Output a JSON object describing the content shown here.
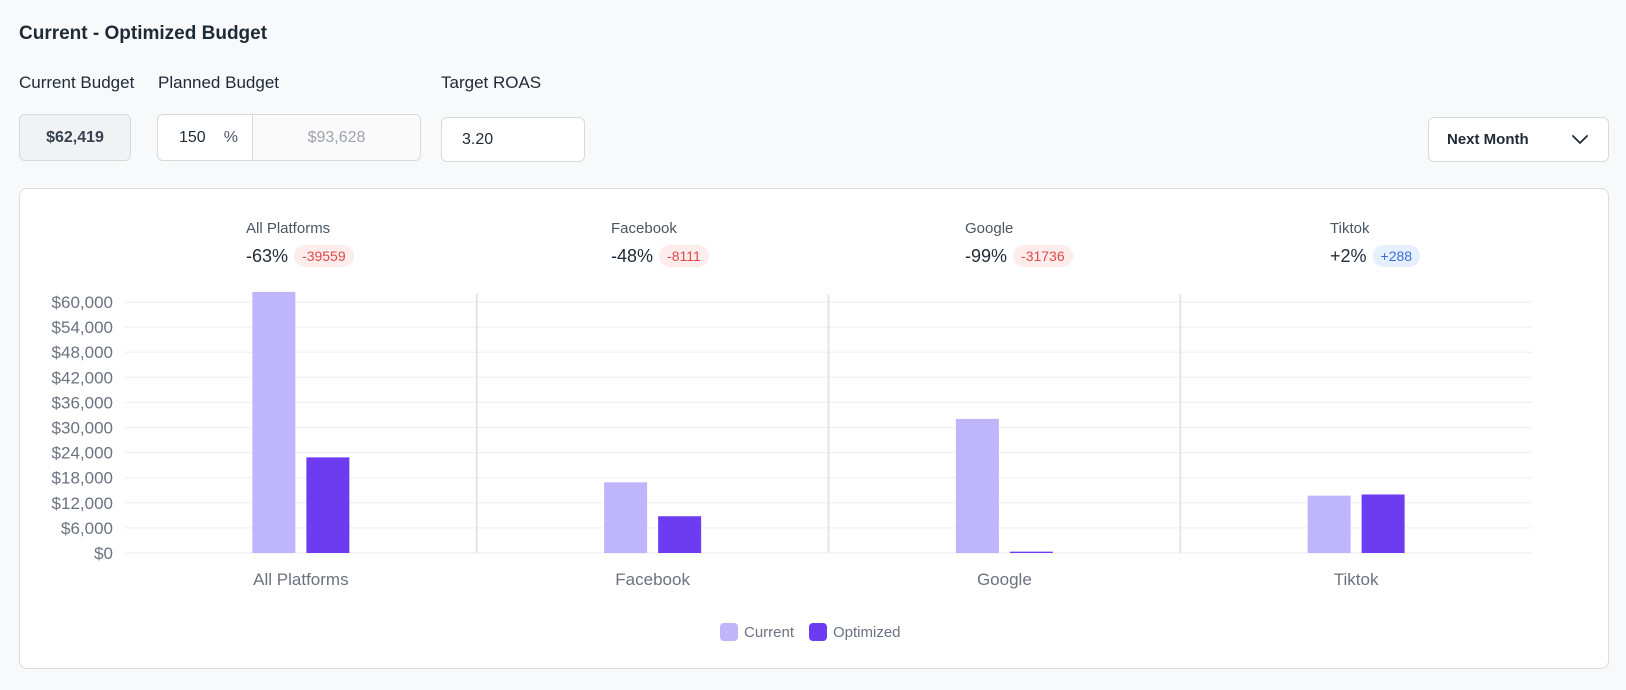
{
  "header": {
    "title": "Current - Optimized Budget",
    "current_budget_label": "Current Budget",
    "planned_budget_label": "Planned Budget",
    "target_roas_label": "Target ROAS",
    "current_budget_value": "$62,419",
    "planned_percent": "150",
    "percent_symbol": "%",
    "planned_amount": "$93,628",
    "target_roas_value": "3.20",
    "period": "Next Month"
  },
  "stats": [
    {
      "name": "All Platforms",
      "pct": "-63%",
      "delta": "-39559",
      "tone": "neg"
    },
    {
      "name": "Facebook",
      "pct": "-48%",
      "delta": "-8111",
      "tone": "neg"
    },
    {
      "name": "Google",
      "pct": "-99%",
      "delta": "-31736",
      "tone": "neg"
    },
    {
      "name": "Tiktok",
      "pct": "+2%",
      "delta": "+288",
      "tone": "pos"
    }
  ],
  "colors": {
    "current": "#bfb5fb",
    "optimized": "#6d3cf0",
    "negative": "#dc4a4a",
    "positive": "#3b6fd8"
  },
  "chart_data": {
    "type": "bar",
    "categories": [
      "All Platforms",
      "Facebook",
      "Google",
      "Tiktok"
    ],
    "series": [
      {
        "name": "Current",
        "values": [
          62419,
          16900,
          32060,
          13700
        ]
      },
      {
        "name": "Optimized",
        "values": [
          22860,
          8789,
          324,
          13988
        ]
      }
    ],
    "ylim": [
      0,
      60000
    ],
    "yticks": [
      "$0",
      "$6,000",
      "$12,000",
      "$18,000",
      "$24,000",
      "$30,000",
      "$36,000",
      "$42,000",
      "$48,000",
      "$54,000",
      "$60,000"
    ],
    "legend": [
      "Current",
      "Optimized"
    ],
    "legend_position": "bottom",
    "grid": true
  }
}
